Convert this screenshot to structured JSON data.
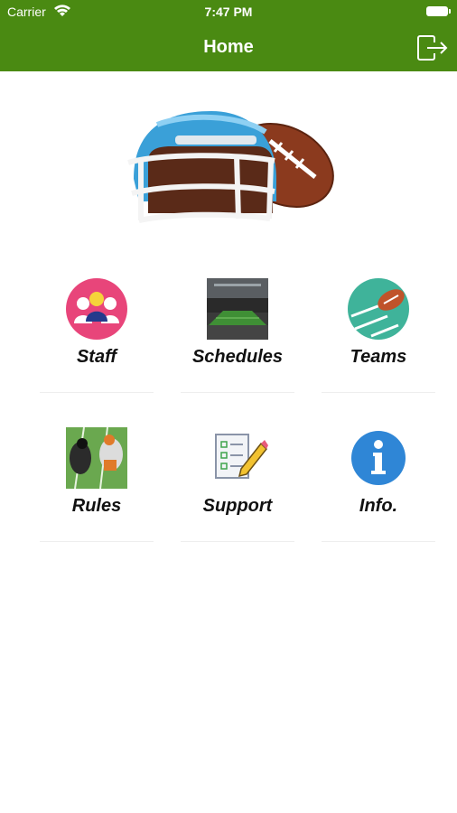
{
  "status_bar": {
    "carrier": "Carrier",
    "time": "7:47 PM"
  },
  "nav": {
    "title": "Home",
    "logout_icon": "logout-icon"
  },
  "hero": {
    "image": "helmet-and-football"
  },
  "tiles": [
    {
      "label": "Staff",
      "icon": "staff-icon"
    },
    {
      "label": "Schedules",
      "icon": "stadium-photo"
    },
    {
      "label": "Teams",
      "icon": "football-field-icon"
    },
    {
      "label": "Rules",
      "icon": "players-photo"
    },
    {
      "label": "Support",
      "icon": "checklist-pencil-icon"
    },
    {
      "label": "Info.",
      "icon": "info-icon"
    }
  ],
  "colors": {
    "nav_bar": "#4a8a12",
    "staff_bg": "#e8457a",
    "teams_bg": "#3fb39a",
    "info_bg": "#2f86d6"
  }
}
